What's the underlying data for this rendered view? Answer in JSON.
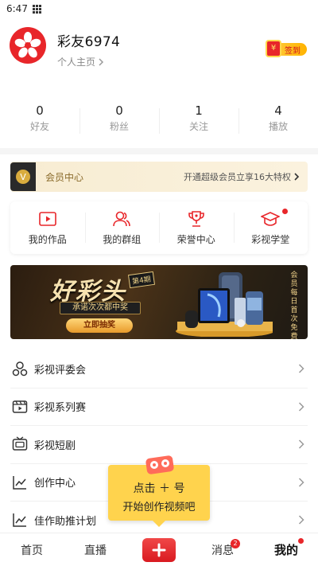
{
  "status_bar": {
    "time": "6:47"
  },
  "profile": {
    "username": "彩友6974",
    "homepage_label": "个人主页",
    "checkin_label": "签到",
    "checkin_bag_symbol": "¥"
  },
  "stats": [
    {
      "value": "0",
      "label": "好友"
    },
    {
      "value": "0",
      "label": "粉丝"
    },
    {
      "value": "1",
      "label": "关注"
    },
    {
      "value": "4",
      "label": "播放"
    }
  ],
  "vip": {
    "icon_letter": "V",
    "title": "会员中心",
    "promo": "开通超级会员立享16大特权"
  },
  "works": [
    {
      "label": "我的作品",
      "icon": "video-play-icon"
    },
    {
      "label": "我的群组",
      "icon": "group-icon"
    },
    {
      "label": "荣誉中心",
      "icon": "trophy-icon"
    },
    {
      "label": "彩视学堂",
      "icon": "graduation-cap-icon"
    }
  ],
  "banner": {
    "logo": "好彩头",
    "issue": "第4期",
    "promise": "承诺次次都中奖",
    "draw_button": "立即抽奖",
    "side_text": "会员每日首次免费"
  },
  "menu": [
    {
      "label": "彩视评委会",
      "icon": "judge-icon"
    },
    {
      "label": "彩视系列赛",
      "icon": "series-video-icon"
    },
    {
      "label": "彩视短剧",
      "icon": "tv-icon"
    },
    {
      "label": "创作中心",
      "icon": "line-chart-icon"
    },
    {
      "label": "佳作助推计划",
      "icon": "growth-chart-icon"
    }
  ],
  "tooltip": {
    "line1": "点击 ＋ 号",
    "line2": "开始创作视频吧"
  },
  "tabbar": {
    "home": "首页",
    "live": "直播",
    "messages": "消息",
    "messages_badge": "2",
    "mine": "我的"
  },
  "colors": {
    "brand_red": "#e8262a",
    "gold": "#ffd34d",
    "vip_text": "#8a6a2a"
  }
}
